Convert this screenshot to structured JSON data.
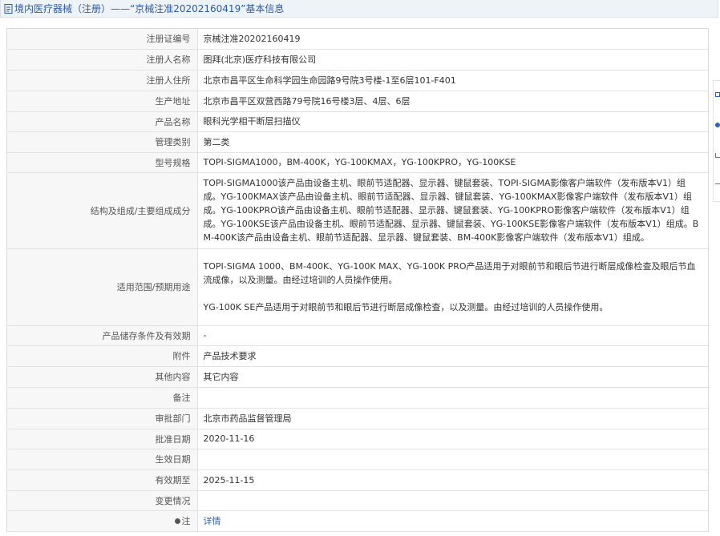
{
  "breadcrumb": {
    "icon": "document-icon",
    "text": "境内医疗器械（注册）——“京械注准20202160419”基本信息"
  },
  "rows": [
    {
      "label": "注册证编号",
      "value": "京械注准20202160419"
    },
    {
      "label": "注册人名称",
      "value": "图拜(北京)医疗科技有限公司"
    },
    {
      "label": "注册人住所",
      "value": "北京市昌平区生命科学园生命园路9号院3号楼-1至6层101-F401"
    },
    {
      "label": "生产地址",
      "value": "北京市昌平区双营西路79号院16号楼3层、4层、6层"
    },
    {
      "label": "产品名称",
      "value": "眼科光学相干断层扫描仪"
    },
    {
      "label": "管理类别",
      "value": "第二类"
    },
    {
      "label": "型号规格",
      "value": "TOPI-SIGMA1000，BM-400K，YG-100KMAX，YG-100KPRO，YG-100KSE"
    },
    {
      "label": "结构及组成/主要组成成分",
      "value": "TOPI-SIGMA1000该产品由设备主机、眼前节适配器、显示器、键鼠套装、TOPI-SIGMA影像客户端软件（发布版本V1）组成。YG-100KMAX该产品由设备主机、眼前节适配器、显示器、键鼠套装、YG-100KMAX影像客户端软件（发布版本V1）组成。YG-100KPRO该产品由设备主机、眼前节适配器、显示器、键鼠套装、YG-100KPRO影像客户端软件（发布版本V1）组成。YG-100KSE该产品由设备主机、眼前节适配器、显示器、键鼠套装、YG-100KSE影像客户端软件（发布版本V1）组成。BM-400K该产品由设备主机、眼前节适配器、显示器、键鼠套装、BM-400K影像客户端软件（发布版本V1）组成。"
    },
    {
      "label": "适用范围/预期用途",
      "value": "TOPI-SIGMA 1000、BM-400K、YG-100K MAX、YG-100K PRO产品适用于对眼前节和眼后节进行断层成像检查及眼后节血流成像，以及测量。由经过培训的人员操作使用。",
      "value2": "YG-100K SE产品适用于对眼前节和眼后节进行断层成像检查，以及测量。由经过培训的人员操作使用。"
    },
    {
      "label": "产品储存条件及有效期",
      "value": "-"
    },
    {
      "label": "附件",
      "value": "产品技术要求"
    },
    {
      "label": "其他内容",
      "value": "其它内容"
    },
    {
      "label": "备注",
      "value": ""
    },
    {
      "label": "审批部门",
      "value": "北京市药品监督管理局"
    },
    {
      "label": "批准日期",
      "value": "2020-11-16"
    },
    {
      "label": "生效日期",
      "value": ""
    },
    {
      "label": "有效期至",
      "value": "2025-11-15"
    },
    {
      "label": "变更情况",
      "value": ""
    },
    {
      "label": "注",
      "value": "详情",
      "icon": "pin-icon"
    }
  ],
  "colors": {
    "link": "#2b64c8",
    "header_bg": "#eef3f8",
    "label_bg": "#f7f7f7"
  }
}
